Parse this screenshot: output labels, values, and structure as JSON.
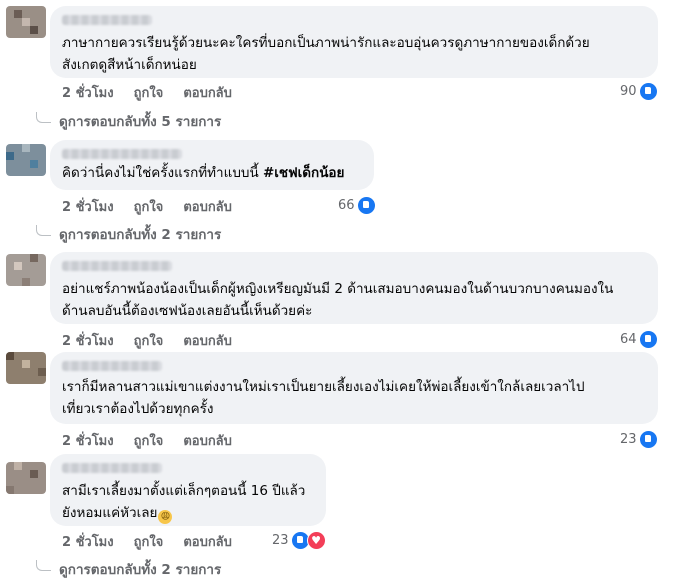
{
  "comments": [
    {
      "lines": [
        "ภาษากายควรเรียนรู้ด้วยนะคะใครที่บอกเป็นภาพน่ารักและอบอุ่นควรดูภาษากายของเด็กด้วย",
        "สังเกตดูสีหน้าเด็กหน่อย"
      ],
      "time": "2 ชั่วโมง",
      "like": "ถูกใจ",
      "reply": "ตอบกลับ",
      "reactions": "90",
      "replies_text": "ดูการตอบกลับทั้ง 5 รายการ"
    },
    {
      "lines": [
        "คิดว่านี่คงไม่ใช่ครั้งแรกที่ทำแบบนี้ "
      ],
      "hashtag": "#เชฟเด็กน้อย",
      "time": "2 ชั่วโมง",
      "like": "ถูกใจ",
      "reply": "ตอบกลับ",
      "reactions": "66",
      "replies_text": "ดูการตอบกลับทั้ง 2 รายการ"
    },
    {
      "lines": [
        "อย่าแชร์ภาพน้องน้องเป็นเด็กผู้หญิงเหรียญมันมี 2 ด้านเสมอบางคนมองในด้านบวกบางคนมองใน",
        "ด้านลบอันนี้ต้องเซฟน้องเลยอันนี้เห็นด้วยค่ะ"
      ],
      "time": "2 ชั่วโมง",
      "like": "ถูกใจ",
      "reply": "ตอบกลับ",
      "reactions": "64"
    },
    {
      "lines": [
        "เราก็มีหลานสาวแม่เขาแต่งงานใหม่เราเป็นยายเลี้ยงเองไม่เคยให้พ่อเลี้ยงเข้าใกล้เลยเวลาไป",
        "เที่ยวเราต้องไปด้วยทุกครั้ง"
      ],
      "time": "2 ชั่วโมง",
      "like": "ถูกใจ",
      "reply": "ตอบกลับ",
      "reactions": "23"
    },
    {
      "lines": [
        "สามีเราเลี้ยงมาตั้งแต่เล็กๆตอนนี้ 16 ปีแล้ว",
        "ยังหอมแค่หัวเลย"
      ],
      "emoji": "😩",
      "time": "2 ชั่วโมง",
      "like": "ถูกใจ",
      "reply": "ตอบกลับ",
      "reactions": "23",
      "replies_text": "ดูการตอบกลับทั้ง 2 รายการ"
    }
  ],
  "colors": {
    "like": "#1877f2",
    "heart": "#f33e58",
    "bubble": "#f0f2f5",
    "meta": "#65676b"
  }
}
